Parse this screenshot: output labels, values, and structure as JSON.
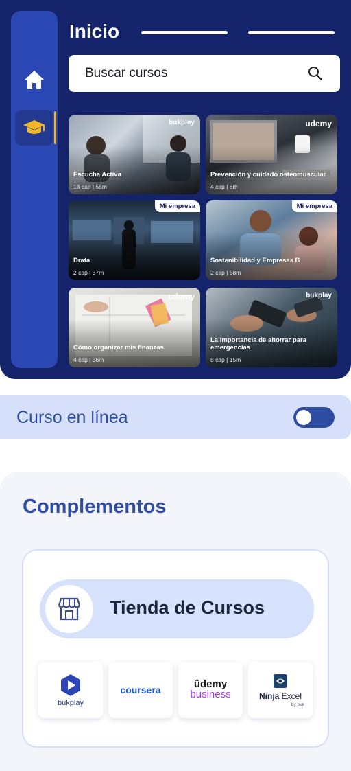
{
  "header": {
    "title": "Inicio"
  },
  "search": {
    "placeholder": "Buscar cursos"
  },
  "courses": [
    {
      "title": "Escucha Activa",
      "meta": "13 cap | 55m",
      "badge": "bukplay"
    },
    {
      "title": "Prevención y cuidado osteomuscular",
      "meta": "4 cap | 6m",
      "badge": "udemy"
    },
    {
      "title": "Drata",
      "meta": "2 cap | 37m",
      "badge": "Mi empresa"
    },
    {
      "title": "Sostenibilidad y Empresas B",
      "meta": "2 cap | 58m",
      "badge": "Mi empresa"
    },
    {
      "title": "Cómo organizar mis finanzas",
      "meta": "4 cap | 36m",
      "badge": "udemy"
    },
    {
      "title": "La importancia de ahorrar para emergencias",
      "meta": "8 cap | 15m",
      "badge": "bukplay"
    }
  ],
  "online": {
    "label": "Curso en línea",
    "enabled": false
  },
  "addons": {
    "title": "Complementos",
    "store_label": "Tienda de Cursos",
    "partners": [
      {
        "name": "bukplay",
        "icon": "bukplay-logo"
      },
      {
        "name": "coursera",
        "icon": "coursera-logo"
      },
      {
        "name": "udemy business",
        "word1": "ûdemy",
        "word2": "business",
        "icon": "udemy-logo"
      },
      {
        "name": "Ninja Excel",
        "word1": "Ninja",
        "word2": "Excel",
        "by": "by buk",
        "icon": "ninja-excel-logo"
      }
    ]
  },
  "colors": {
    "navy": "#15246a",
    "rail": "#2b47b4",
    "accent": "#f2b626",
    "primary": "#2f4ea3"
  }
}
